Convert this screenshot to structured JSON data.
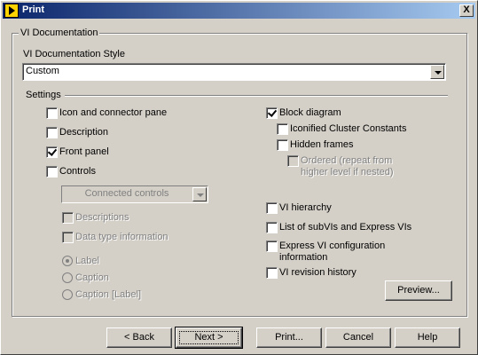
{
  "window": {
    "title": "Print",
    "close_glyph": "X"
  },
  "doc_group": {
    "legend": "VI Documentation",
    "style_label": "VI Documentation Style",
    "style_value": "Custom"
  },
  "settings": {
    "legend": "Settings",
    "left": {
      "icon_connector": {
        "label": "Icon and connector pane",
        "checked": false
      },
      "description": {
        "label": "Description",
        "checked": false
      },
      "front_panel": {
        "label": "Front panel",
        "checked": true
      },
      "controls": {
        "label": "Controls",
        "checked": false
      },
      "controls_combo": "Connected controls",
      "descriptions": {
        "label": "Descriptions",
        "checked": false,
        "enabled": false
      },
      "data_type": {
        "label": "Data type information",
        "checked": false,
        "enabled": false
      },
      "radio_options": [
        {
          "label": "Label",
          "selected": true
        },
        {
          "label": "Caption",
          "selected": false
        },
        {
          "label": "Caption [Label]",
          "selected": false
        }
      ]
    },
    "right": {
      "block_diagram": {
        "label": "Block diagram",
        "checked": true
      },
      "iconified": {
        "label": "Iconified Cluster Constants",
        "checked": false
      },
      "hidden_frames": {
        "label": "Hidden frames",
        "checked": false
      },
      "ordered_line1": "Ordered (repeat from",
      "ordered_line2": "higher level if nested)",
      "vi_hierarchy": {
        "label": "VI hierarchy",
        "checked": false
      },
      "subvis": {
        "label": "List of subVIs and Express VIs",
        "checked": false
      },
      "express_config_line1": "Express VI configuration",
      "express_config_line2": "information",
      "revision_history": {
        "label": "VI revision history",
        "checked": false
      },
      "preview_button": "Preview..."
    }
  },
  "footer": {
    "back": "< Back",
    "next": "Next >",
    "print": "Print...",
    "cancel": "Cancel",
    "help": "Help"
  }
}
